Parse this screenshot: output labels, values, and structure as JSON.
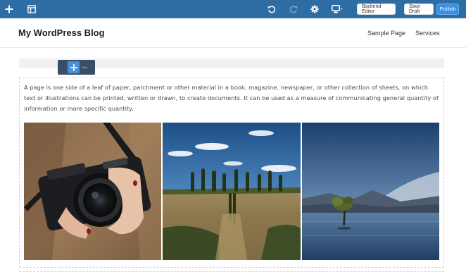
{
  "toolbar": {
    "add_icon": "plus-icon",
    "layout_icon": "layout-icon",
    "undo_icon": "undo-icon",
    "redo_icon": "redo-icon",
    "settings_icon": "gear-icon",
    "device_icon": "monitor-icon",
    "backend_editor_label": "Backend Editor",
    "save_draft_label": "Save Draft",
    "publish_label": "Publish",
    "accent_color": "#2e6da4",
    "publish_color": "#3b8fe0"
  },
  "site": {
    "title": "My WordPress Blog",
    "nav": [
      {
        "label": "Sample Page"
      },
      {
        "label": "Services"
      }
    ]
  },
  "row_control": {
    "add_icon": "plus-icon",
    "label": "Row"
  },
  "content": {
    "paragraph": "A page is one side of a leaf of paper, parchment or other material in a book, magazine, newspaper, or other collection of sheets, on which text or illustrations can be printed, written or drawn, to create documents. It can be used as a measure of communicating general quantity of information or more specific quantity.",
    "gallery": [
      {
        "subject": "camera-photo"
      },
      {
        "subject": "tuscan-landscape-photo"
      },
      {
        "subject": "lake-tree-photo"
      }
    ]
  }
}
